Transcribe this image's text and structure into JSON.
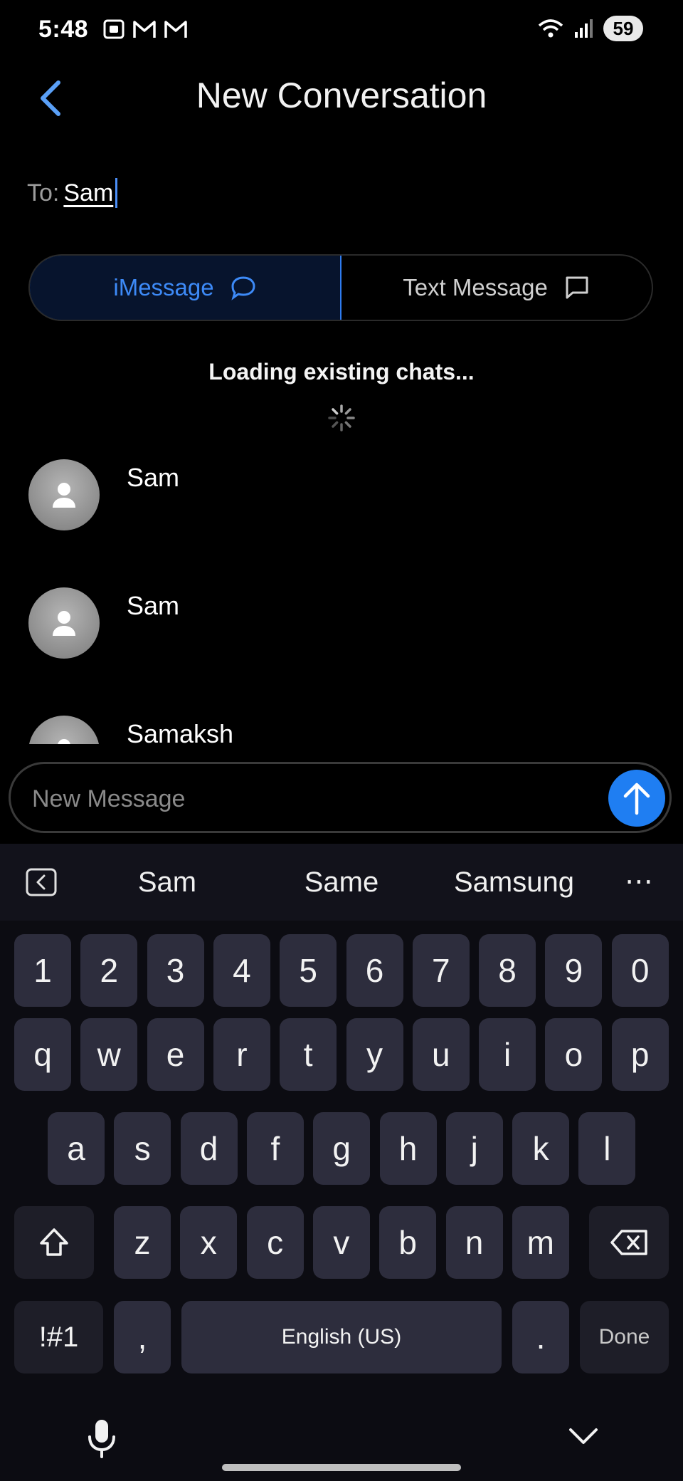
{
  "status_bar": {
    "time": "5:48",
    "battery": "59"
  },
  "header": {
    "title": "New Conversation"
  },
  "to_field": {
    "label": "To:",
    "value": "Sam"
  },
  "mode_toggle": {
    "imessage_label": "iMessage",
    "text_message_label": "Text Message",
    "active": "iMessage"
  },
  "loading_text": "Loading existing chats...",
  "contacts": [
    {
      "name": "Sam"
    },
    {
      "name": "Sam"
    },
    {
      "name": "Samaksh"
    }
  ],
  "message_bar": {
    "placeholder": "New Message"
  },
  "keyboard": {
    "suggestions": [
      "Sam",
      "Same",
      "Samsung"
    ],
    "row_numbers": [
      "1",
      "2",
      "3",
      "4",
      "5",
      "6",
      "7",
      "8",
      "9",
      "0"
    ],
    "row_1": [
      "q",
      "w",
      "e",
      "r",
      "t",
      "y",
      "u",
      "i",
      "o",
      "p"
    ],
    "row_2": [
      "a",
      "s",
      "d",
      "f",
      "g",
      "h",
      "j",
      "k",
      "l"
    ],
    "row_3": [
      "z",
      "x",
      "c",
      "v",
      "b",
      "n",
      "m"
    ],
    "symbols_label": "!#1",
    "comma_label": ",",
    "space_label": "English (US)",
    "period_label": ".",
    "done_label": "Done"
  },
  "colors": {
    "accent": "#2f7cf0",
    "send_button": "#1f7ef2",
    "key_bg": "#2d2d3d"
  }
}
